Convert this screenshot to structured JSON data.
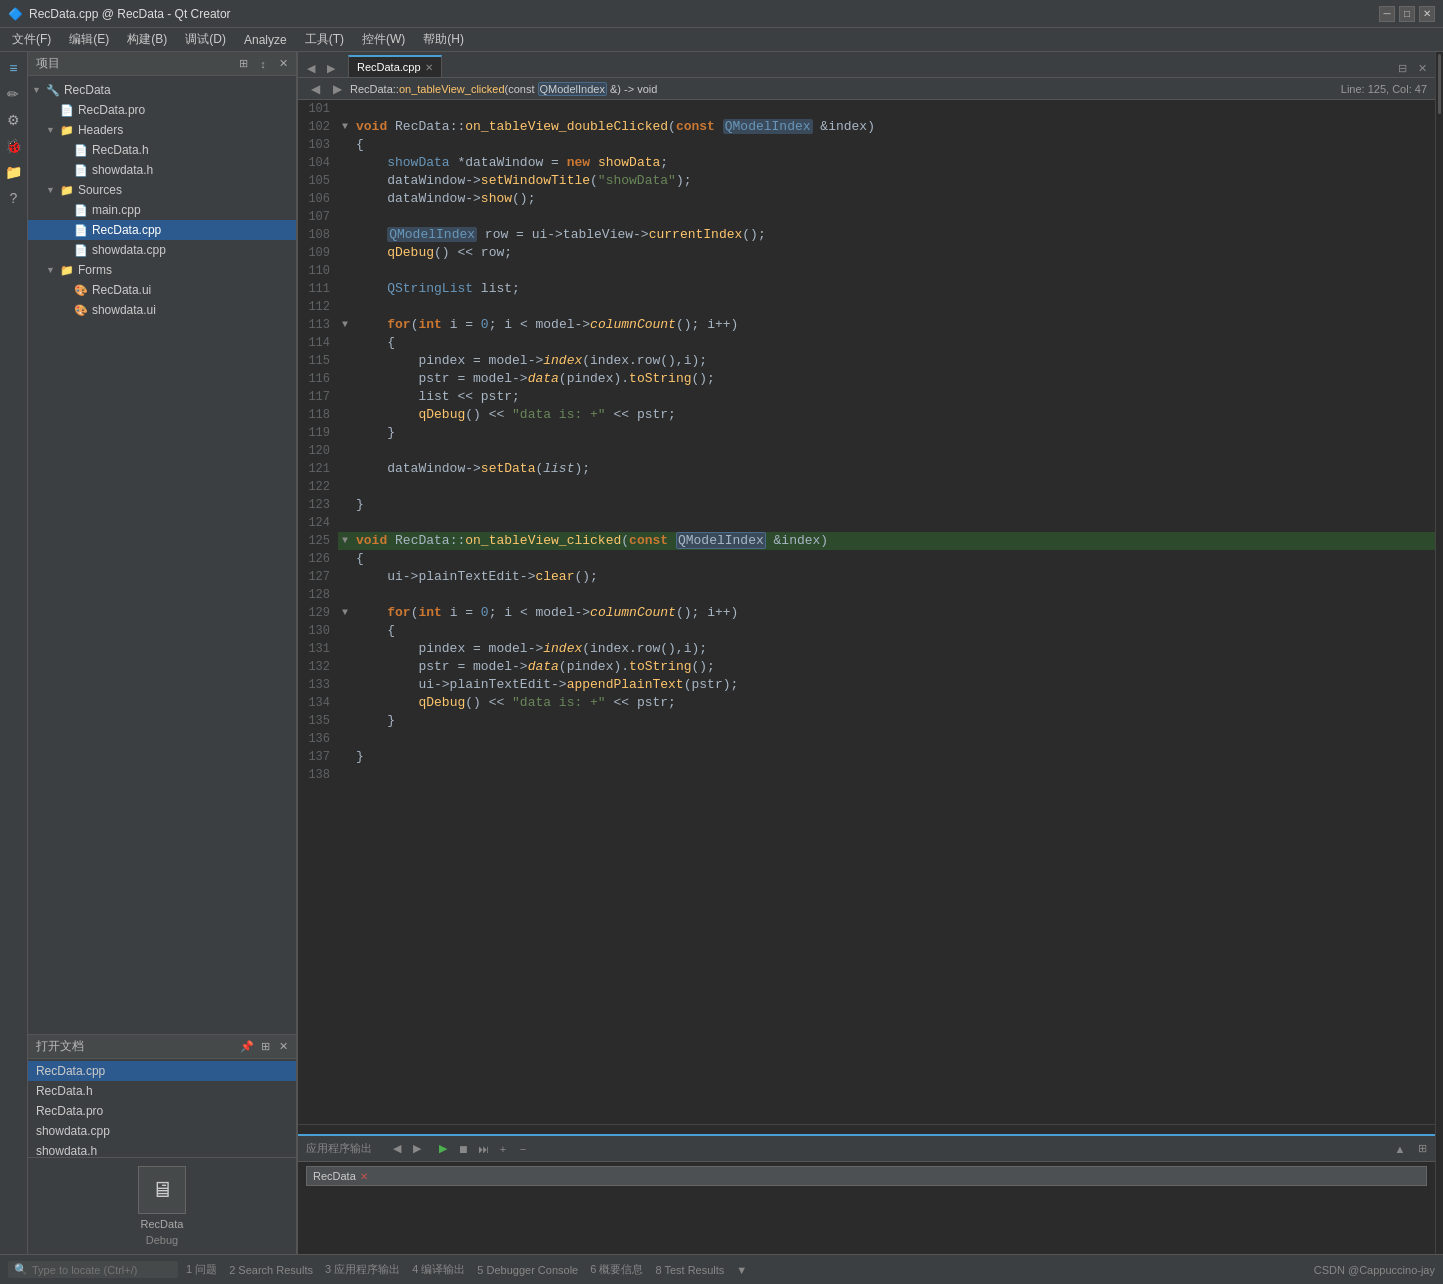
{
  "titleBar": {
    "title": "RecData.cpp @ RecData - Qt Creator",
    "minimize": "─",
    "maximize": "□",
    "close": "✕"
  },
  "menuBar": {
    "items": [
      "文件(F)",
      "编辑(E)",
      "构建(B)",
      "调试(D)",
      "Analyze",
      "工具(T)",
      "控件(W)",
      "帮助(H)"
    ]
  },
  "leftPanel": {
    "projectLabel": "项目",
    "tree": [
      {
        "indent": 0,
        "arrow": "▼",
        "icon": "🔧",
        "label": "RecData",
        "type": "project"
      },
      {
        "indent": 1,
        "arrow": "",
        "icon": "📄",
        "label": "RecData.pro",
        "type": "file"
      },
      {
        "indent": 1,
        "arrow": "▼",
        "icon": "📁",
        "label": "Headers",
        "type": "folder"
      },
      {
        "indent": 2,
        "arrow": "",
        "icon": "📄",
        "label": "RecData.h",
        "type": "file"
      },
      {
        "indent": 2,
        "arrow": "",
        "icon": "📄",
        "label": "showdata.h",
        "type": "file"
      },
      {
        "indent": 1,
        "arrow": "▼",
        "icon": "📁",
        "label": "Sources",
        "type": "folder"
      },
      {
        "indent": 2,
        "arrow": "",
        "icon": "📄",
        "label": "main.cpp",
        "type": "file"
      },
      {
        "indent": 2,
        "arrow": "",
        "icon": "📄",
        "label": "RecData.cpp",
        "type": "file",
        "selected": true
      },
      {
        "indent": 2,
        "arrow": "",
        "icon": "📄",
        "label": "showdata.cpp",
        "type": "file"
      },
      {
        "indent": 1,
        "arrow": "▼",
        "icon": "📁",
        "label": "Forms",
        "type": "folder"
      },
      {
        "indent": 2,
        "arrow": "",
        "icon": "🎨",
        "label": "RecData.ui",
        "type": "file"
      },
      {
        "indent": 2,
        "arrow": "",
        "icon": "🎨",
        "label": "showdata.ui",
        "type": "file"
      }
    ]
  },
  "openDocs": {
    "label": "打开文档",
    "files": [
      "RecData.cpp",
      "RecData.h",
      "RecData.pro",
      "showdata.cpp",
      "showdata.h"
    ]
  },
  "editor": {
    "tabs": [
      {
        "label": "RecData.cpp",
        "active": true
      },
      {
        "label": "RecData::on_tableView_clicked(const QModelIndex &) -> void",
        "active": false
      }
    ],
    "locationPath": "RecData::on_tableView_clicked(const QModelIndex &) -> void",
    "lineCol": "Line: 125, Col: 47",
    "lines": [
      {
        "num": 101,
        "fold": "",
        "content": ""
      },
      {
        "num": 102,
        "fold": "▼",
        "content": "void RecData::on_tableView_doubleClicked(const QModelIndex &index)"
      },
      {
        "num": 103,
        "fold": "",
        "content": "{"
      },
      {
        "num": 104,
        "fold": "",
        "content": "    showData *dataWindow = new showData;"
      },
      {
        "num": 105,
        "fold": "",
        "content": "    dataWindow->setWindowTitle(\"showData\");"
      },
      {
        "num": 106,
        "fold": "",
        "content": "    dataWindow->show();"
      },
      {
        "num": 107,
        "fold": "",
        "content": ""
      },
      {
        "num": 108,
        "fold": "",
        "content": "    QModelIndex row = ui->tableView->currentIndex();"
      },
      {
        "num": 109,
        "fold": "",
        "content": "    qDebug() << row;"
      },
      {
        "num": 110,
        "fold": "",
        "content": ""
      },
      {
        "num": 111,
        "fold": "",
        "content": "    QStringList list;"
      },
      {
        "num": 112,
        "fold": "",
        "content": ""
      },
      {
        "num": 113,
        "fold": "▼",
        "content": "    for(int i = 0; i < model->columnCount(); i++)"
      },
      {
        "num": 114,
        "fold": "",
        "content": "    {"
      },
      {
        "num": 115,
        "fold": "",
        "content": "        pindex = model->index(index.row(),i);"
      },
      {
        "num": 116,
        "fold": "",
        "content": "        pstr = model->data(pindex).toString();"
      },
      {
        "num": 117,
        "fold": "",
        "content": "        list << pstr;"
      },
      {
        "num": 118,
        "fold": "",
        "content": "        qDebug() << \"data is: +\" << pstr;"
      },
      {
        "num": 119,
        "fold": "",
        "content": "    }"
      },
      {
        "num": 120,
        "fold": "",
        "content": ""
      },
      {
        "num": 121,
        "fold": "",
        "content": "    dataWindow->setData(list);"
      },
      {
        "num": 122,
        "fold": "",
        "content": ""
      },
      {
        "num": 123,
        "fold": "",
        "content": "}"
      },
      {
        "num": 124,
        "fold": "",
        "content": ""
      },
      {
        "num": 125,
        "fold": "▼",
        "content": "void RecData::on_tableView_clicked(const QModelIndex &index)"
      },
      {
        "num": 126,
        "fold": "",
        "content": "{"
      },
      {
        "num": 127,
        "fold": "",
        "content": "    ui->plainTextEdit->clear();"
      },
      {
        "num": 128,
        "fold": "",
        "content": ""
      },
      {
        "num": 129,
        "fold": "▼",
        "content": "    for(int i = 0; i < model->columnCount(); i++)"
      },
      {
        "num": 130,
        "fold": "",
        "content": "    {"
      },
      {
        "num": 131,
        "fold": "",
        "content": "        pindex = model->index(index.row(),i);"
      },
      {
        "num": 132,
        "fold": "",
        "content": "        pstr = model->data(pindex).toString();"
      },
      {
        "num": 133,
        "fold": "",
        "content": "        ui->plainTextEdit->appendPlainText(pstr);"
      },
      {
        "num": 134,
        "fold": "",
        "content": "        qDebug() << \"data is: +\" << pstr;"
      },
      {
        "num": 135,
        "fold": "",
        "content": "    }"
      },
      {
        "num": 136,
        "fold": "",
        "content": ""
      },
      {
        "num": 137,
        "fold": "",
        "content": "}"
      },
      {
        "num": 138,
        "fold": "",
        "content": ""
      }
    ]
  },
  "bottomPanel": {
    "label": "应用程序输出",
    "tabs": [
      "应用程序输出"
    ],
    "activeTab": "RecData",
    "closeBtn": "✕"
  },
  "recdataPreview": {
    "label": "RecData",
    "debug": "Debug"
  },
  "statusBar": {
    "searchPlaceholder": "Type to locate (Ctrl+/)",
    "items": [
      {
        "num": 1,
        "label": "问题"
      },
      {
        "num": 2,
        "label": "Search Results"
      },
      {
        "num": 3,
        "label": "应用程序输出"
      },
      {
        "num": 4,
        "label": "编译输出"
      },
      {
        "num": 5,
        "label": "Debugger Console"
      },
      {
        "num": 6,
        "label": "概要信息"
      },
      {
        "num": 8,
        "label": "Test Results"
      }
    ],
    "rightLabel": "CSDN @Cappuccino-jay"
  },
  "sidebarIcons": {
    "icons": [
      {
        "name": "project-icon",
        "symbol": "≡",
        "active": true
      },
      {
        "name": "edit-icon",
        "symbol": "✏",
        "active": false
      },
      {
        "name": "build-icon",
        "symbol": "⚙",
        "active": false
      },
      {
        "name": "debug-icon",
        "symbol": "🐛",
        "active": false
      },
      {
        "name": "project2-icon",
        "symbol": "📁",
        "active": false
      },
      {
        "name": "help-icon",
        "symbol": "?",
        "active": false
      }
    ],
    "bottomIcons": [
      {
        "name": "build-bottom-icon",
        "symbol": "⚙"
      },
      {
        "name": "debug-bottom-icon",
        "symbol": "▶"
      },
      {
        "name": "run-icon",
        "symbol": "▶"
      },
      {
        "name": "step-icon",
        "symbol": "⏭"
      },
      {
        "name": "locate-icon",
        "symbol": "⊕"
      }
    ]
  }
}
